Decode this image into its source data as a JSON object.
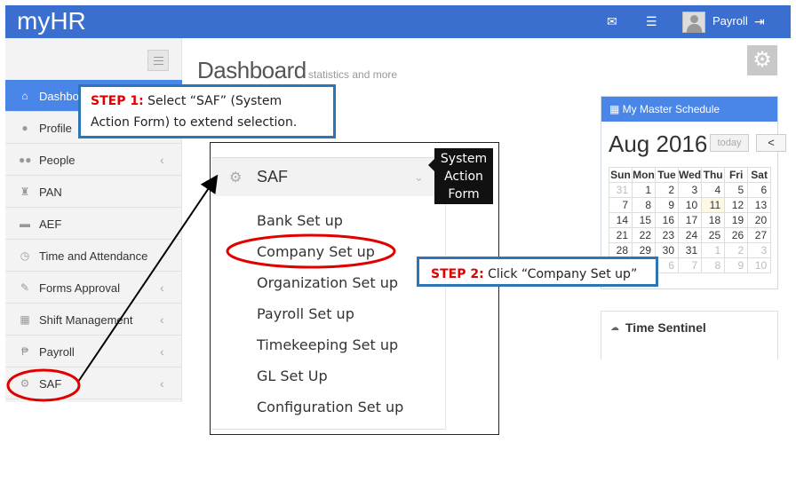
{
  "app": {
    "title": "myHR",
    "user_name": "Payroll"
  },
  "topbar_icons": [
    "mail-icon",
    "tasks-icon",
    "avatar",
    "logout-icon"
  ],
  "sidebar": {
    "items": [
      {
        "label": "Dashboard",
        "icon": "home-icon",
        "glyph": "⌂",
        "chevron": false,
        "active": true
      },
      {
        "label": "Profile",
        "icon": "user-icon",
        "glyph": "●",
        "chevron": false
      },
      {
        "label": "People",
        "icon": "group-icon",
        "glyph": "●●",
        "chevron": true
      },
      {
        "label": "PAN",
        "icon": "trophy-icon",
        "glyph": "♜",
        "chevron": false
      },
      {
        "label": "AEF",
        "icon": "folder-icon",
        "glyph": "▬",
        "chevron": false
      },
      {
        "label": "Time and Attendance",
        "icon": "clock-icon",
        "glyph": "◷",
        "chevron": false
      },
      {
        "label": "Forms Approval",
        "icon": "pencil-icon",
        "glyph": "✎",
        "chevron": true
      },
      {
        "label": "Shift Management",
        "icon": "calendar-icon",
        "glyph": "▦",
        "chevron": true
      },
      {
        "label": "Payroll",
        "icon": "peso-icon",
        "glyph": "₱",
        "chevron": true
      },
      {
        "label": "SAF",
        "icon": "gear-icon",
        "glyph": "⚙",
        "chevron": true
      }
    ],
    "chevron_glyph": "‹"
  },
  "dashboard": {
    "title": "Dashboard",
    "subtitle": "statistics and more"
  },
  "calendar": {
    "header": "My Master Schedule",
    "month": "Aug 2016",
    "today_label": "today",
    "prev_label": "<",
    "weekdays": [
      "Sun",
      "Mon",
      "Tue",
      "Wed",
      "Thu",
      "Fri",
      "Sat"
    ],
    "weeks": [
      [
        "31",
        "1",
        "2",
        "3",
        "4",
        "5",
        "6"
      ],
      [
        "7",
        "8",
        "9",
        "10",
        "11",
        "12",
        "13"
      ],
      [
        "14",
        "15",
        "16",
        "17",
        "18",
        "19",
        "20"
      ],
      [
        "21",
        "22",
        "23",
        "24",
        "25",
        "26",
        "27"
      ],
      [
        "28",
        "29",
        "30",
        "31",
        "1",
        "2",
        "3"
      ],
      [
        "4",
        "5",
        "6",
        "7",
        "8",
        "9",
        "10"
      ]
    ],
    "today_day": "11"
  },
  "time_sentinel": {
    "label": "Time Sentinel"
  },
  "step1": {
    "step": "STEP 1:",
    "text_line1": " Select “SAF” (System",
    "text_line2": "Action Form) to extend selection."
  },
  "step2": {
    "step": "STEP 2:",
    "text": " Click “Company Set up”"
  },
  "saf_menu": {
    "title": "SAF",
    "items": [
      "Bank Set up",
      "Company Set up",
      "Organization Set up",
      "Payroll Set up",
      "Timekeeping Set up",
      "GL Set Up",
      "Configuration Set up"
    ]
  },
  "tooltip": {
    "lines": [
      "System",
      "Action",
      "Form"
    ]
  },
  "colors": {
    "brand": "#3a6fd0",
    "active": "#4a86e8",
    "callout_border": "#2e75b6",
    "highlight": "#e00000"
  }
}
